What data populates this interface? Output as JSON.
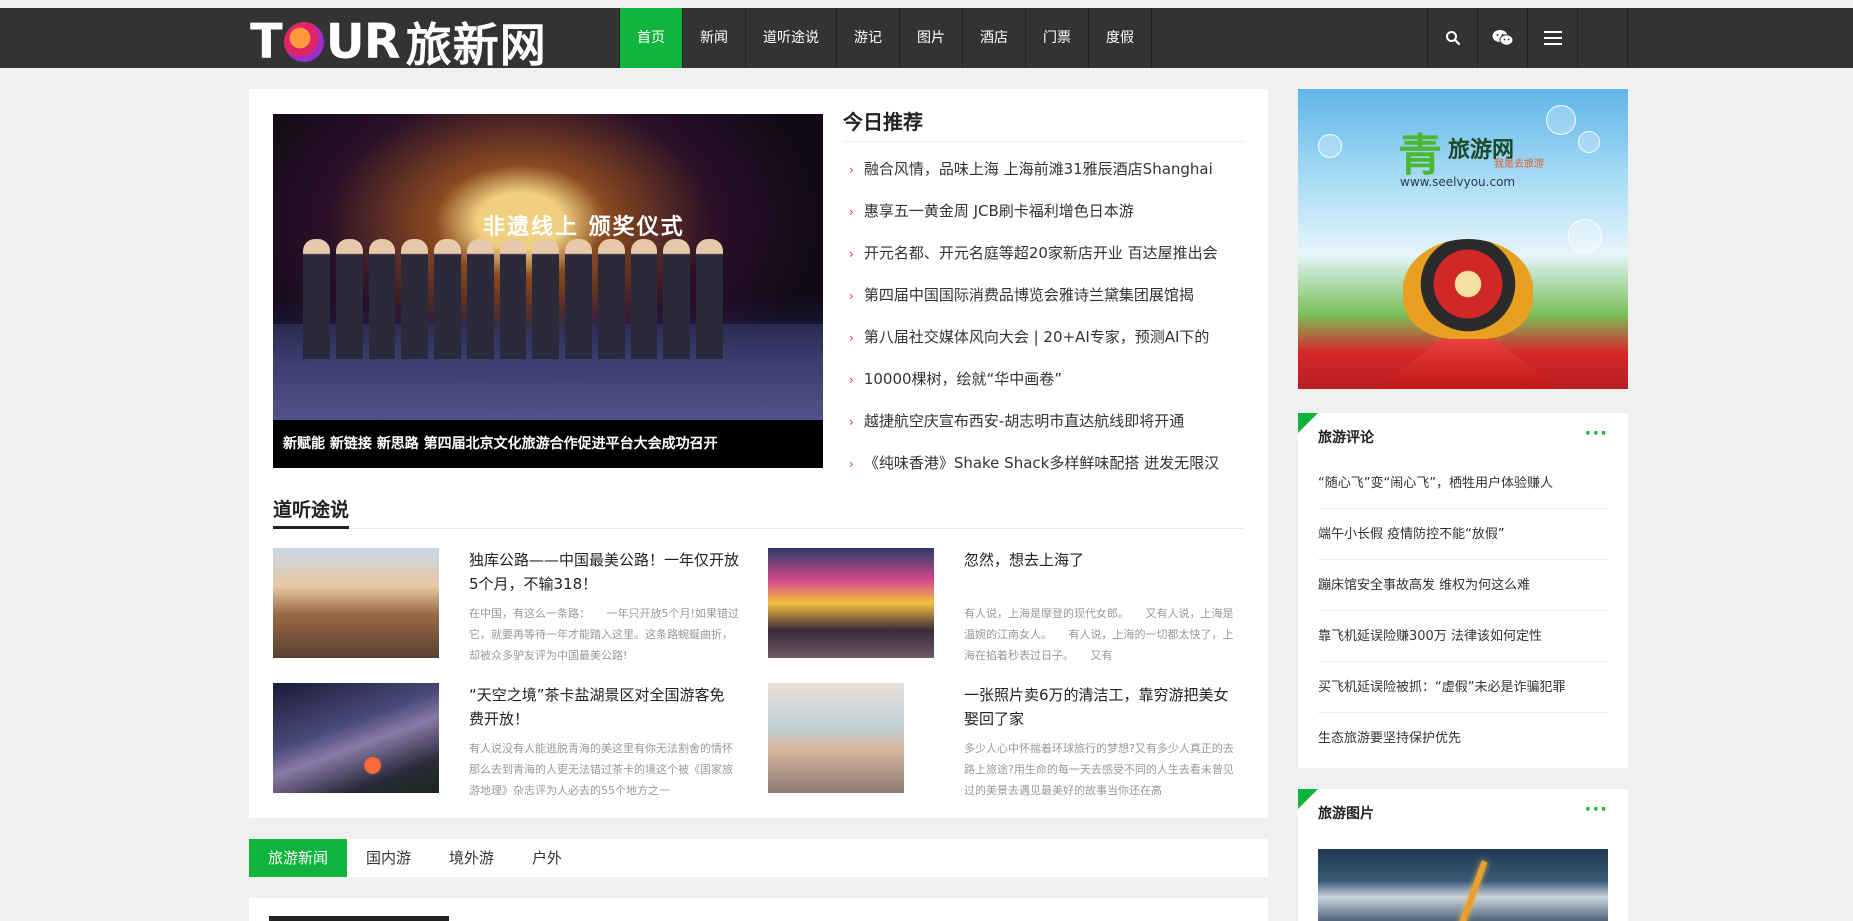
{
  "logo": {
    "text_before": "T",
    "text_after": "UR",
    "text_cn": "旅新网"
  },
  "nav": {
    "items": [
      {
        "label": "首页",
        "active": true
      },
      {
        "label": "新闻",
        "active": false
      },
      {
        "label": "道听途说",
        "active": false
      },
      {
        "label": "游记",
        "active": false
      },
      {
        "label": "图片",
        "active": false
      },
      {
        "label": "酒店",
        "active": false
      },
      {
        "label": "门票",
        "active": false
      },
      {
        "label": "度假",
        "active": false
      }
    ],
    "icons": [
      "search-icon",
      "wechat-icon",
      "menu-icon"
    ],
    "accent": "#0fb43c",
    "bar_color": "#333333"
  },
  "slider": {
    "overlay_text": "非遗线上 颁奖仪式",
    "caption": "新赋能 新链接 新思路 第四届北京文化旅游合作促进平台大会成功召开"
  },
  "today": {
    "title": "今日推荐",
    "items": [
      "融合风情，品味上海 上海前滩31雅辰酒店Shanghai",
      "惠享五一黄金周 JCB刷卡福利增色日本游",
      "开元名都、开元名庭等超20家新店开业 百达屋推出会",
      "第四届中国国际消费品博览会雅诗兰黛集团展馆揭",
      "第八届社交媒体风向大会 | 20+AI专家，预测AI下的",
      "10000棵树，绘就“华中画卷”",
      "越捷航空庆宣布西安-胡志明市直达航线即将开通",
      "《纯味香港》Shake Shack多样鲜味配搭 迸发无限汉"
    ]
  },
  "section": {
    "title": "道听途说",
    "articles": [
      {
        "title": "独库公路——中国最美公路！一年仅开放5个月，不输318！",
        "desc": "在中国，有这么一条路：　　一年只开放5个月!如果错过它，就要再等待一年才能踏入这里。这条路蜿蜒曲折，却被众多驴友评为中国最美公路!"
      },
      {
        "title": "忽然，想去上海了",
        "desc": "有人说，上海是摩登的现代女郎。　　又有人说，上海是温婉的江南女人。　　有人说，上海的一切都太快了，上海在掐着秒表过日子。　　又有"
      },
      {
        "title": "“天空之境”茶卡盐湖景区对全国游客免费开放！",
        "desc": "有人说没有人能逃脱青海的美这里有你无法割舍的情怀那么去到青海的人更无法错过茶卡的境这个被《国家旅游地理》杂志评为人必去的55个地方之一"
      },
      {
        "title": "一张照片卖6万的清洁工，靠穷游把美女娶回了家",
        "desc": "多少人心中怀揣着环球旅行的梦想?又有多少人真正的去路上旅途?用生命的每一天去感受不同的人生去看未曾见过的美景去遇见最美好的故事当你还在高"
      }
    ]
  },
  "tabs": [
    {
      "label": "旅游新闻",
      "active": true
    },
    {
      "label": "国内游",
      "active": false
    },
    {
      "label": "境外游",
      "active": false
    },
    {
      "label": "户外",
      "active": false
    }
  ],
  "ad": {
    "brand": "旅游网",
    "brand_glyph": "青",
    "slogan": "我是去旅游",
    "url": "www.seelvyou.com"
  },
  "comments": {
    "title": "旅游评论",
    "more": "···",
    "items": [
      "“随心飞”变“闹心飞”，栖牲用户体验赚人",
      "端午小长假 疫情防控不能“放假”",
      "蹦床馆安全事故高发 维权为何这么难",
      "靠飞机延误险赚300万 法律该如何定性",
      "买飞机延误险被抓：“虚假”未必是诈骗犯罪",
      "生态旅游要坚持保护优先"
    ]
  },
  "photos": {
    "title": "旅游图片",
    "more": "···"
  }
}
